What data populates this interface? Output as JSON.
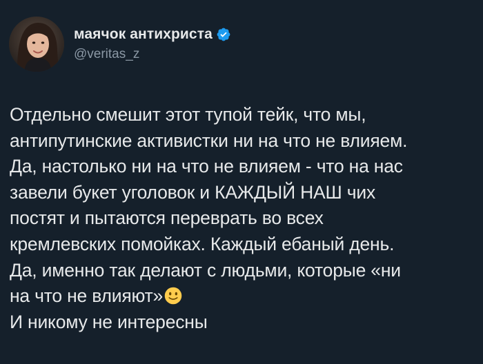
{
  "author": {
    "display_name": "маячок антихриста",
    "handle": "@veritas_z",
    "verified": true,
    "avatar_icon": "profile-photo"
  },
  "tweet": {
    "lines": [
      "Отдельно смешит этот тупой тейк, что мы,",
      "антипутинские активистки ни на что не влияем.",
      "Да, настолько ни на что не влияем - что на нас",
      "завели букет уголовок и КАЖДЫЙ НАШ чих",
      "постят и пытаются переврать во всех",
      "кремлевских помойках. Каждый ебаный день.",
      "Да, именно так делают с людьми, которые «ни",
      "на что не влияют»",
      "И никому не интересны"
    ],
    "emoji": "slightly-smiling-face"
  },
  "colors": {
    "background": "#15202b",
    "text": "#e7e9ea",
    "secondary_text": "#8b98a5",
    "verified_badge": "#1d9bf0"
  }
}
